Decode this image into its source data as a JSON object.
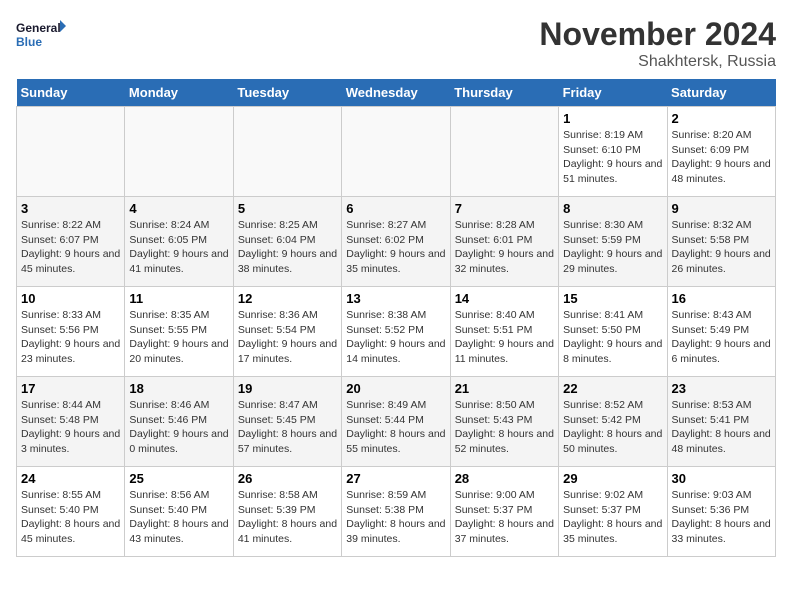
{
  "logo": {
    "line1": "General",
    "line2": "Blue"
  },
  "title": "November 2024",
  "subtitle": "Shakhtersk, Russia",
  "days_of_week": [
    "Sunday",
    "Monday",
    "Tuesday",
    "Wednesday",
    "Thursday",
    "Friday",
    "Saturday"
  ],
  "weeks": [
    [
      {
        "day": "",
        "info": ""
      },
      {
        "day": "",
        "info": ""
      },
      {
        "day": "",
        "info": ""
      },
      {
        "day": "",
        "info": ""
      },
      {
        "day": "",
        "info": ""
      },
      {
        "day": "1",
        "info": "Sunrise: 8:19 AM\nSunset: 6:10 PM\nDaylight: 9 hours and 51 minutes."
      },
      {
        "day": "2",
        "info": "Sunrise: 8:20 AM\nSunset: 6:09 PM\nDaylight: 9 hours and 48 minutes."
      }
    ],
    [
      {
        "day": "3",
        "info": "Sunrise: 8:22 AM\nSunset: 6:07 PM\nDaylight: 9 hours and 45 minutes."
      },
      {
        "day": "4",
        "info": "Sunrise: 8:24 AM\nSunset: 6:05 PM\nDaylight: 9 hours and 41 minutes."
      },
      {
        "day": "5",
        "info": "Sunrise: 8:25 AM\nSunset: 6:04 PM\nDaylight: 9 hours and 38 minutes."
      },
      {
        "day": "6",
        "info": "Sunrise: 8:27 AM\nSunset: 6:02 PM\nDaylight: 9 hours and 35 minutes."
      },
      {
        "day": "7",
        "info": "Sunrise: 8:28 AM\nSunset: 6:01 PM\nDaylight: 9 hours and 32 minutes."
      },
      {
        "day": "8",
        "info": "Sunrise: 8:30 AM\nSunset: 5:59 PM\nDaylight: 9 hours and 29 minutes."
      },
      {
        "day": "9",
        "info": "Sunrise: 8:32 AM\nSunset: 5:58 PM\nDaylight: 9 hours and 26 minutes."
      }
    ],
    [
      {
        "day": "10",
        "info": "Sunrise: 8:33 AM\nSunset: 5:56 PM\nDaylight: 9 hours and 23 minutes."
      },
      {
        "day": "11",
        "info": "Sunrise: 8:35 AM\nSunset: 5:55 PM\nDaylight: 9 hours and 20 minutes."
      },
      {
        "day": "12",
        "info": "Sunrise: 8:36 AM\nSunset: 5:54 PM\nDaylight: 9 hours and 17 minutes."
      },
      {
        "day": "13",
        "info": "Sunrise: 8:38 AM\nSunset: 5:52 PM\nDaylight: 9 hours and 14 minutes."
      },
      {
        "day": "14",
        "info": "Sunrise: 8:40 AM\nSunset: 5:51 PM\nDaylight: 9 hours and 11 minutes."
      },
      {
        "day": "15",
        "info": "Sunrise: 8:41 AM\nSunset: 5:50 PM\nDaylight: 9 hours and 8 minutes."
      },
      {
        "day": "16",
        "info": "Sunrise: 8:43 AM\nSunset: 5:49 PM\nDaylight: 9 hours and 6 minutes."
      }
    ],
    [
      {
        "day": "17",
        "info": "Sunrise: 8:44 AM\nSunset: 5:48 PM\nDaylight: 9 hours and 3 minutes."
      },
      {
        "day": "18",
        "info": "Sunrise: 8:46 AM\nSunset: 5:46 PM\nDaylight: 9 hours and 0 minutes."
      },
      {
        "day": "19",
        "info": "Sunrise: 8:47 AM\nSunset: 5:45 PM\nDaylight: 8 hours and 57 minutes."
      },
      {
        "day": "20",
        "info": "Sunrise: 8:49 AM\nSunset: 5:44 PM\nDaylight: 8 hours and 55 minutes."
      },
      {
        "day": "21",
        "info": "Sunrise: 8:50 AM\nSunset: 5:43 PM\nDaylight: 8 hours and 52 minutes."
      },
      {
        "day": "22",
        "info": "Sunrise: 8:52 AM\nSunset: 5:42 PM\nDaylight: 8 hours and 50 minutes."
      },
      {
        "day": "23",
        "info": "Sunrise: 8:53 AM\nSunset: 5:41 PM\nDaylight: 8 hours and 48 minutes."
      }
    ],
    [
      {
        "day": "24",
        "info": "Sunrise: 8:55 AM\nSunset: 5:40 PM\nDaylight: 8 hours and 45 minutes."
      },
      {
        "day": "25",
        "info": "Sunrise: 8:56 AM\nSunset: 5:40 PM\nDaylight: 8 hours and 43 minutes."
      },
      {
        "day": "26",
        "info": "Sunrise: 8:58 AM\nSunset: 5:39 PM\nDaylight: 8 hours and 41 minutes."
      },
      {
        "day": "27",
        "info": "Sunrise: 8:59 AM\nSunset: 5:38 PM\nDaylight: 8 hours and 39 minutes."
      },
      {
        "day": "28",
        "info": "Sunrise: 9:00 AM\nSunset: 5:37 PM\nDaylight: 8 hours and 37 minutes."
      },
      {
        "day": "29",
        "info": "Sunrise: 9:02 AM\nSunset: 5:37 PM\nDaylight: 8 hours and 35 minutes."
      },
      {
        "day": "30",
        "info": "Sunrise: 9:03 AM\nSunset: 5:36 PM\nDaylight: 8 hours and 33 minutes."
      }
    ]
  ]
}
